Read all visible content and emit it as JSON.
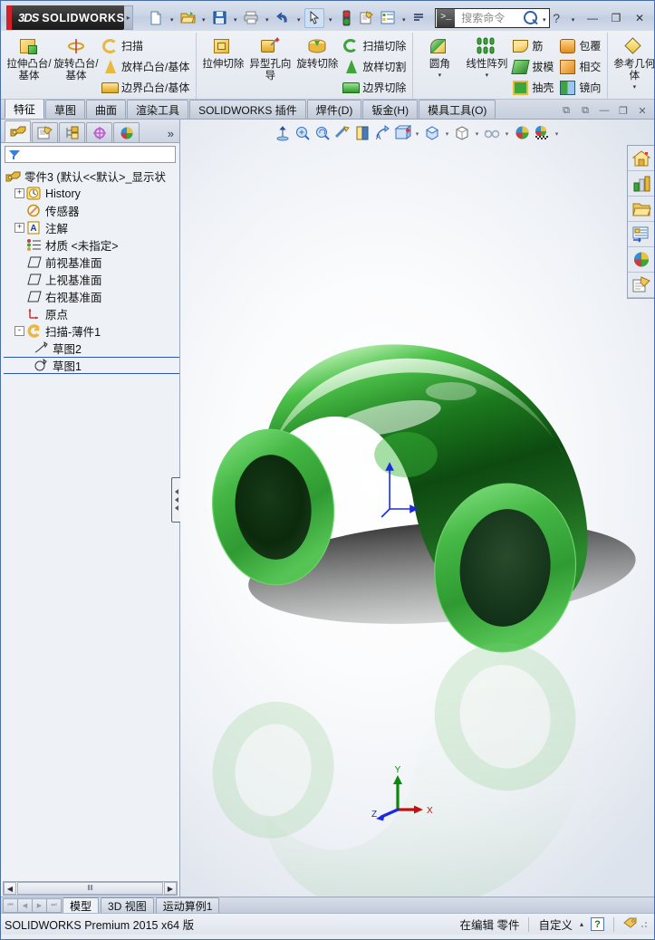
{
  "app": {
    "brand_ds": "3DS",
    "brand_name": "SOLIDWORKS",
    "logo_arrow": "▸"
  },
  "quick_access": {
    "buttons": [
      {
        "name": "new-document",
        "icon": "new-file-icon",
        "has_caret": true
      },
      {
        "name": "open-document",
        "icon": "open-folder-icon",
        "has_caret": true
      },
      {
        "name": "save-document",
        "icon": "save-disk-icon",
        "has_caret": true
      },
      {
        "name": "print-document",
        "icon": "printer-icon",
        "has_caret": true
      },
      {
        "name": "undo",
        "icon": "undo-arrow-icon",
        "has_caret": true
      },
      {
        "name": "select",
        "icon": "cursor-arrow-icon",
        "has_caret": true
      },
      {
        "name": "rebuild",
        "icon": "traffic-light-icon",
        "has_caret": false
      },
      {
        "name": "options",
        "icon": "options-gear-icon",
        "has_caret": false
      },
      {
        "name": "display-list",
        "icon": "checklist-icon",
        "has_caret": true
      },
      {
        "name": "more-commands",
        "icon": "overflow-icon",
        "has_caret": false
      }
    ]
  },
  "search": {
    "placeholder": "搜索命令",
    "command_icon": "command-prompt-icon",
    "magnifier_icon": "magnifier-icon",
    "caret": "▾"
  },
  "window_controls": {
    "help": "?",
    "help_caret": "▾",
    "minimize": "—",
    "restore": "❐",
    "close": "✕"
  },
  "ribbon": {
    "groups": [
      {
        "name": "boss-base-group",
        "big": [
          {
            "label": "拉伸凸台/基体",
            "icon": "extruded-boss-icon"
          },
          {
            "label": "旋转凸台/基体",
            "icon": "revolved-boss-icon"
          }
        ],
        "small": [
          {
            "label": "扫描",
            "icon": "swept-boss-icon"
          },
          {
            "label": "放样凸台/基体",
            "icon": "lofted-boss-icon"
          },
          {
            "label": "边界凸台/基体",
            "icon": "boundary-boss-icon"
          }
        ]
      },
      {
        "name": "cut-group",
        "big": [
          {
            "label": "拉伸切除",
            "icon": "extruded-cut-icon"
          },
          {
            "label": "异型孔向导",
            "icon": "hole-wizard-icon"
          },
          {
            "label": "旋转切除",
            "icon": "revolved-cut-icon"
          }
        ],
        "small": [
          {
            "label": "扫描切除",
            "icon": "swept-cut-icon"
          },
          {
            "label": "放样切割",
            "icon": "lofted-cut-icon"
          },
          {
            "label": "边界切除",
            "icon": "boundary-cut-icon"
          }
        ]
      },
      {
        "name": "feature-group",
        "big": [
          {
            "label": "圆角",
            "icon": "fillet-icon",
            "dropdown": "▾"
          },
          {
            "label": "线性阵列",
            "icon": "linear-pattern-icon",
            "dropdown": "▾"
          }
        ],
        "small": [
          {
            "label": "筋",
            "icon": "rib-icon"
          },
          {
            "label": "拔模",
            "icon": "draft-icon"
          },
          {
            "label": "抽壳",
            "icon": "shell-icon"
          }
        ],
        "small2": [
          {
            "label": "包覆",
            "icon": "wrap-icon"
          },
          {
            "label": "相交",
            "icon": "intersect-icon"
          },
          {
            "label": "镜向",
            "icon": "mirror-icon"
          }
        ]
      },
      {
        "name": "reference-group",
        "big": [
          {
            "label": "参考几何体",
            "icon": "reference-geometry-icon",
            "dropdown": "▾"
          }
        ]
      }
    ],
    "overflow": "»"
  },
  "command_tabs": {
    "tabs": [
      {
        "label": "特征",
        "active": true
      },
      {
        "label": "草图",
        "active": false
      },
      {
        "label": "曲面",
        "active": false
      },
      {
        "label": "渲染工具",
        "active": false
      },
      {
        "label": "SOLIDWORKS 插件",
        "active": false
      },
      {
        "label": "焊件(D)",
        "active": false
      },
      {
        "label": "钣金(H)",
        "active": false
      },
      {
        "label": "模具工具(O)",
        "active": false
      }
    ],
    "doc_buttons": [
      {
        "name": "doc-restore-left",
        "glyph": "⧉"
      },
      {
        "name": "doc-restore-right",
        "glyph": "⧉"
      },
      {
        "name": "doc-minimize",
        "glyph": "—"
      },
      {
        "name": "doc-restore",
        "glyph": "❐"
      },
      {
        "name": "doc-close",
        "glyph": "✕"
      }
    ]
  },
  "feature_manager": {
    "tabs": [
      {
        "name": "feature-tree-tab",
        "icon": "feature-tree-icon",
        "active": true
      },
      {
        "name": "property-manager-tab",
        "icon": "property-manager-icon",
        "active": false
      },
      {
        "name": "configuration-manager-tab",
        "icon": "configuration-icon",
        "active": false
      },
      {
        "name": "dimxpert-manager-tab",
        "icon": "dimxpert-icon",
        "active": false
      },
      {
        "name": "display-manager-tab",
        "icon": "display-manager-icon",
        "active": false
      }
    ],
    "more": "»",
    "filter_icon": "filter-funnel-icon",
    "filter_value": "",
    "tree": [
      {
        "label": "零件3  (默认<<默认>_显示状",
        "icon": "part-icon",
        "indent": 0,
        "expander": ""
      },
      {
        "label": "History",
        "icon": "history-icon",
        "indent": 1,
        "expander": "+"
      },
      {
        "label": "传感器",
        "icon": "sensors-icon",
        "indent": 1,
        "expander": ""
      },
      {
        "label": "注解",
        "icon": "annotations-icon",
        "indent": 1,
        "expander": "+"
      },
      {
        "label": "材质 <未指定>",
        "icon": "material-icon",
        "indent": 1,
        "expander": ""
      },
      {
        "label": "前视基准面",
        "icon": "plane-icon",
        "indent": 1,
        "expander": ""
      },
      {
        "label": "上视基准面",
        "icon": "plane-icon",
        "indent": 1,
        "expander": ""
      },
      {
        "label": "右视基准面",
        "icon": "plane-icon",
        "indent": 1,
        "expander": ""
      },
      {
        "label": "原点",
        "icon": "origin-icon",
        "indent": 1,
        "expander": ""
      },
      {
        "label": "扫描-薄件1",
        "icon": "sweep-thin-icon",
        "indent": 1,
        "expander": "-"
      },
      {
        "label": "草图2",
        "icon": "sketch2-icon",
        "indent": 2,
        "expander": ""
      },
      {
        "label": "草图1",
        "icon": "sketch1-icon",
        "indent": 2,
        "expander": "",
        "selected": true
      }
    ],
    "hscroll": {
      "left": "◀",
      "right": "▶",
      "thumb": "‖‖"
    }
  },
  "view_toolbar": {
    "buttons": [
      {
        "name": "zoom-to-fit-button",
        "icon": "zoom-fit-icon",
        "caret": false
      },
      {
        "name": "zoom-to-area-button",
        "icon": "zoom-area-icon",
        "caret": false
      },
      {
        "name": "previous-view-button",
        "icon": "previous-view-icon",
        "caret": false
      },
      {
        "name": "section-view-button",
        "icon": "section-view-icon",
        "caret": false
      },
      {
        "name": "view-orientation-button",
        "icon": "view-orientation-icon",
        "caret": false
      },
      {
        "name": "display-style-button",
        "icon": "display-style-icon",
        "caret": false
      },
      {
        "name": "hide-show-button",
        "icon": "hide-show-icon",
        "caret": true
      },
      {
        "name": "edit-appearance-button",
        "icon": "appearance-cube-icon",
        "caret": true
      },
      {
        "name": "apply-scene-button",
        "icon": "scene-icon",
        "caret": true
      },
      {
        "name": "view-settings-button",
        "icon": "glasses-icon",
        "caret": true
      },
      {
        "name": "display-manager-button",
        "icon": "color-sphere-icon",
        "caret": false
      },
      {
        "name": "realview-button",
        "icon": "realview-icon",
        "caret": true
      }
    ]
  },
  "right_dock": {
    "buttons": [
      {
        "name": "solidworks-resources-button",
        "icon": "home-icon"
      },
      {
        "name": "design-library-button",
        "icon": "library-chart-icon"
      },
      {
        "name": "file-explorer-button",
        "icon": "folder-icon"
      },
      {
        "name": "view-palette-button",
        "icon": "view-palette-icon"
      },
      {
        "name": "appearances-scenes-button",
        "icon": "color-sphere-icon"
      },
      {
        "name": "custom-properties-button",
        "icon": "custom-properties-icon"
      }
    ]
  },
  "graphics": {
    "triad": {
      "x_label": "X",
      "y_label": "Y",
      "z_label": "Z"
    },
    "model_color": "#35a437",
    "model_name": "green-elbow-pipe"
  },
  "bottom": {
    "nav": [
      "⏮",
      "◀",
      "▶",
      "⏭"
    ],
    "tabs": [
      {
        "label": "模型",
        "active": true
      },
      {
        "label": "3D 视图",
        "active": false
      },
      {
        "label": "运动算例1",
        "active": false
      }
    ]
  },
  "status_bar": {
    "version": "SOLIDWORKS Premium 2015 x64 版",
    "editing": "在编辑 零件",
    "custom": "自定义",
    "custom_caret": "▴",
    "help_mark": "?",
    "tag_icon": "tag-icon"
  }
}
